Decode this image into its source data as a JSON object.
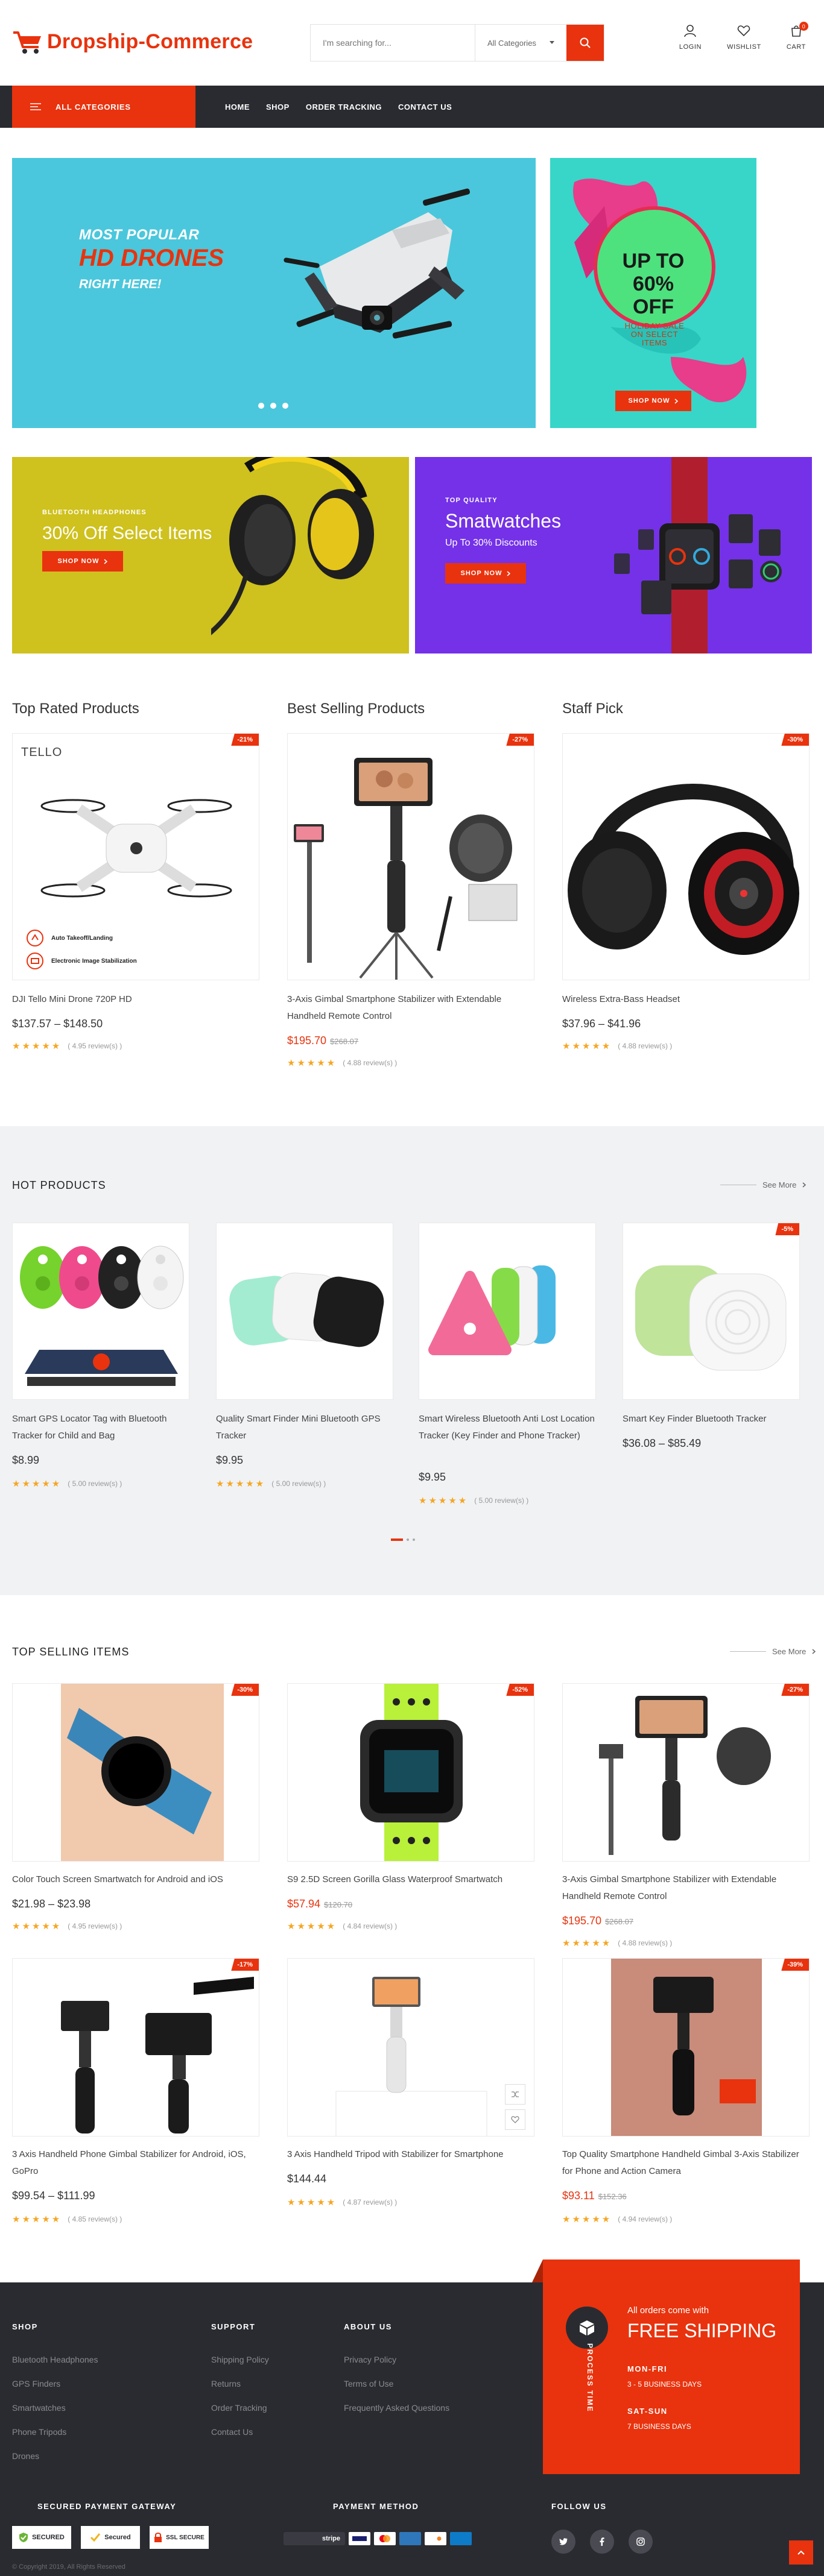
{
  "header": {
    "logo": "Dropship-Commerce",
    "search_placeholder": "I'm searching for...",
    "category_select": "All Categories",
    "login": "LOGIN",
    "wishlist": "WISHLIST",
    "cart": "CART",
    "cart_count": "0"
  },
  "nav": {
    "all_categories": "ALL CATEGORIES",
    "items": [
      "HOME",
      "SHOP",
      "ORDER TRACKING",
      "CONTACT US"
    ]
  },
  "slider": {
    "line1": "MOST POPULAR",
    "line2": "HD DRONES",
    "line3": "RIGHT HERE!"
  },
  "promo": {
    "line1": "UP TO",
    "line2": "60%",
    "line3": "OFF",
    "small": "HOLIDAY SALE ON SELECT ITEMS",
    "button": "SHOP NOW"
  },
  "banner_headphones": {
    "kicker": "BLUETOOTH HEADPHONES",
    "title": "30% Off Select Items",
    "button": "SHOP NOW"
  },
  "banner_watches": {
    "kicker": "TOP QUALITY",
    "title": "Smatwatches",
    "subtitle": "Up To 30% Discounts",
    "button": "SHOP NOW"
  },
  "top_columns": [
    {
      "heading": "Top Rated Products",
      "sale": "-21%",
      "name": "DJI Tello Mini Drone 720P HD",
      "price": "$137.57 – $148.50",
      "old_price": "",
      "rating": "( 4.95 review(s) )",
      "img_text_1": "TELLO",
      "img_text_2": "Auto Takeoff/Landing",
      "img_text_3": "Electronic Image Stabilization"
    },
    {
      "heading": "Best Selling Products",
      "sale": "-27%",
      "name": "3-Axis Gimbal Smartphone Stabilizer with Extendable Handheld Remote Control",
      "price": "$195.70",
      "old_price": "$268.07",
      "rating": "( 4.88 review(s) )"
    },
    {
      "heading": "Staff Pick",
      "sale": "-30%",
      "name": "Wireless Extra-Bass Headset",
      "price": "$37.96 – $41.96",
      "old_price": "",
      "rating": "( 4.88 review(s) )"
    }
  ],
  "hot": {
    "title": "HOT PRODUCTS",
    "see_more": "See More",
    "items": [
      {
        "name": "Smart GPS Locator Tag with Bluetooth Tracker for Child and Bag",
        "price": "$8.99",
        "rating": "( 5.00 review(s) )",
        "sale": ""
      },
      {
        "name": "Quality Smart Finder Mini Bluetooth GPS Tracker",
        "price": "$9.95",
        "rating": "( 5.00 review(s) )",
        "sale": ""
      },
      {
        "name": "Smart Wireless Bluetooth Anti Lost Location Tracker (Key Finder and Phone Tracker)",
        "price": "$9.95",
        "rating": "( 5.00 review(s) )",
        "sale": ""
      },
      {
        "name": "Smart Key Finder Bluetooth Tracker",
        "price": "$36.08 – $85.49",
        "rating": "",
        "sale": "-5%"
      }
    ]
  },
  "selling": {
    "title": "TOP SELLING ITEMS",
    "see_more": "See More",
    "items": [
      {
        "name": "Color Touch Screen Smartwatch for Android and iOS",
        "price": "$21.98 – $23.98",
        "old_price": "",
        "rating": "( 4.95 review(s) )",
        "sale": "-30%"
      },
      {
        "name": "S9 2.5D Screen Gorilla Glass Waterproof Smartwatch",
        "price": "$57.94",
        "old_price": "$120.70",
        "rating": "( 4.84 review(s) )",
        "sale": "-52%"
      },
      {
        "name": "3-Axis Gimbal Smartphone Stabilizer with Extendable Handheld Remote Control",
        "price": "$195.70",
        "old_price": "$268.07",
        "rating": "( 4.88 review(s) )",
        "sale": "-27%"
      },
      {
        "name": "3 Axis Handheld Phone Gimbal Stabilizer for Android, iOS, GoPro",
        "price": "$99.54 – $111.99",
        "old_price": "",
        "rating": "( 4.85 review(s) )",
        "sale": "-17%"
      },
      {
        "name": "3 Axis Handheld Tripod with Stabilizer for Smartphone",
        "price": "$144.44",
        "old_price": "",
        "rating": "( 4.87 review(s) )",
        "sale": ""
      },
      {
        "name": "Top Quality Smartphone Handheld Gimbal 3-Axis Stabilizer for Phone and Action Camera",
        "price": "$93.11",
        "old_price": "$152.36",
        "rating": "( 4.94 review(s) )",
        "sale": "-39%"
      }
    ]
  },
  "footer": {
    "shop_title": "SHOP",
    "shop_links": [
      "Bluetooth Headphones",
      "GPS Finders",
      "Smartwatches",
      "Phone Tripods",
      "Drones"
    ],
    "support_title": "SUPPORT",
    "support_links": [
      "Shipping Policy",
      "Returns",
      "Order Tracking",
      "Contact Us"
    ],
    "about_title": "ABOUT US",
    "about_links": [
      "Privacy Policy",
      "Terms of Use",
      "Frequently Asked Questions"
    ],
    "process_time": "PROCESS TIME",
    "ship_small": "All orders come with",
    "ship_big": "FREE SHIPPING",
    "monfri": "MON-FRI",
    "monfri_days": "3 - 5 BUSINESS DAYS",
    "satsun": "SAT-SUN",
    "satsun_days": "7 BUSINESS DAYS",
    "secured_title": "SECURED PAYMENT GATEWAY",
    "badges": [
      "SECURED",
      "Secured",
      "SSL SECURE"
    ],
    "payment_title": "PAYMENT METHOD",
    "stripe": "stripe",
    "follow_title": "FOLLOW US",
    "copyright": "© Copyright 2019, All Rights Reserved"
  }
}
